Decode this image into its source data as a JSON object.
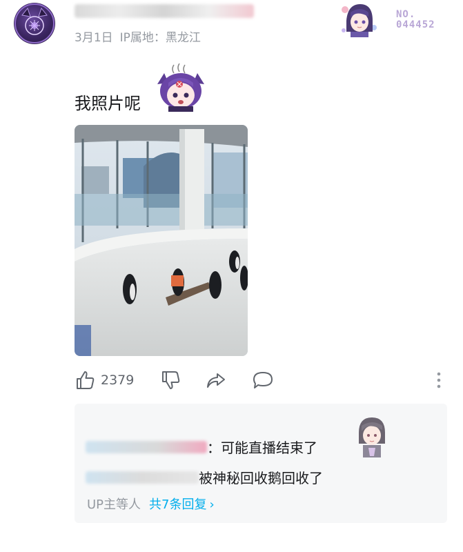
{
  "comment": {
    "date": "3月1日",
    "ip_location": "IP属地：黑龙江",
    "text": "我照片呢",
    "like_count": "2379",
    "badge_number_line1": "NO.",
    "badge_number_line2": "044452"
  },
  "replies": {
    "items": [
      {
        "text": "：可能直播结束了"
      },
      {
        "text": "被神秘回收鹅回收了"
      }
    ],
    "up_label": "UP主等人",
    "count_label": "共7条回复",
    "chevron": "›"
  },
  "colors": {
    "link": "#00aeec",
    "muted": "#9499a0",
    "reply_bg": "#f6f7f8"
  },
  "icons": [
    "like-icon",
    "dislike-icon",
    "share-icon",
    "reply-icon",
    "more-vertical-icon"
  ]
}
